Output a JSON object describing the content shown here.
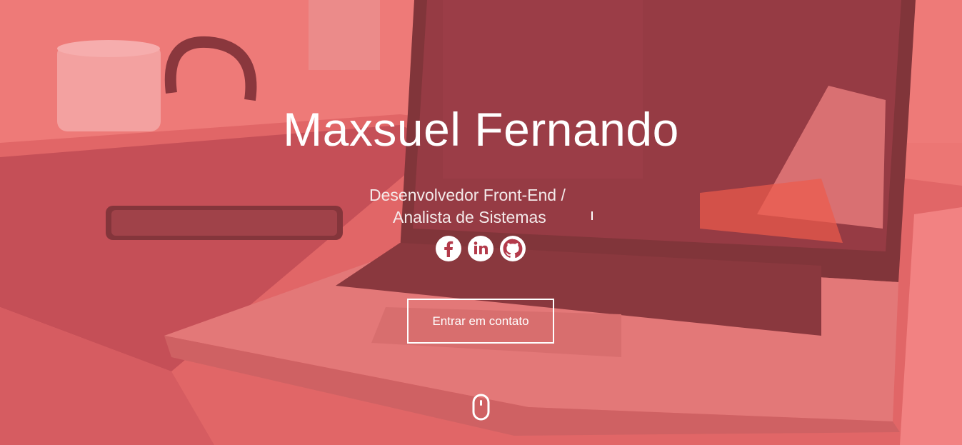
{
  "hero": {
    "name": "Maxsuel Fernando",
    "subtitle_line1": "Desenvolvedor Front-End /",
    "subtitle_line2": "Analista de Sistemas",
    "cta_label": "Entrar em contato"
  },
  "social": [
    {
      "icon": "facebook-icon"
    },
    {
      "icon": "linkedin-icon"
    },
    {
      "icon": "github-icon"
    }
  ],
  "colors": {
    "overlay": "#f46060",
    "accent": "#b33a4a",
    "text": "#ffffff"
  }
}
